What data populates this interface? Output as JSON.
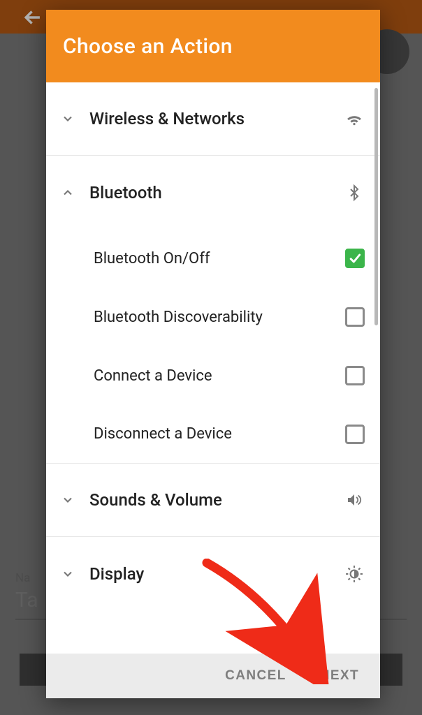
{
  "background": {
    "name_label": "Na",
    "name_value": "Ta"
  },
  "dialog": {
    "title": "Choose an Action",
    "footer": {
      "cancel": "CANCEL",
      "next": "NEXT"
    },
    "groups": [
      {
        "id": "wireless",
        "label": "Wireless & Networks",
        "expanded": false,
        "icon": "wifi"
      },
      {
        "id": "bluetooth",
        "label": "Bluetooth",
        "expanded": true,
        "icon": "bluetooth",
        "items": [
          {
            "label": "Bluetooth On/Off",
            "checked": true
          },
          {
            "label": "Bluetooth Discoverability",
            "checked": false
          },
          {
            "label": "Connect a Device",
            "checked": false
          },
          {
            "label": "Disconnect a Device",
            "checked": false
          }
        ]
      },
      {
        "id": "sounds",
        "label": "Sounds & Volume",
        "expanded": false,
        "icon": "volume"
      },
      {
        "id": "display",
        "label": "Display",
        "expanded": false,
        "icon": "brightness"
      }
    ]
  }
}
